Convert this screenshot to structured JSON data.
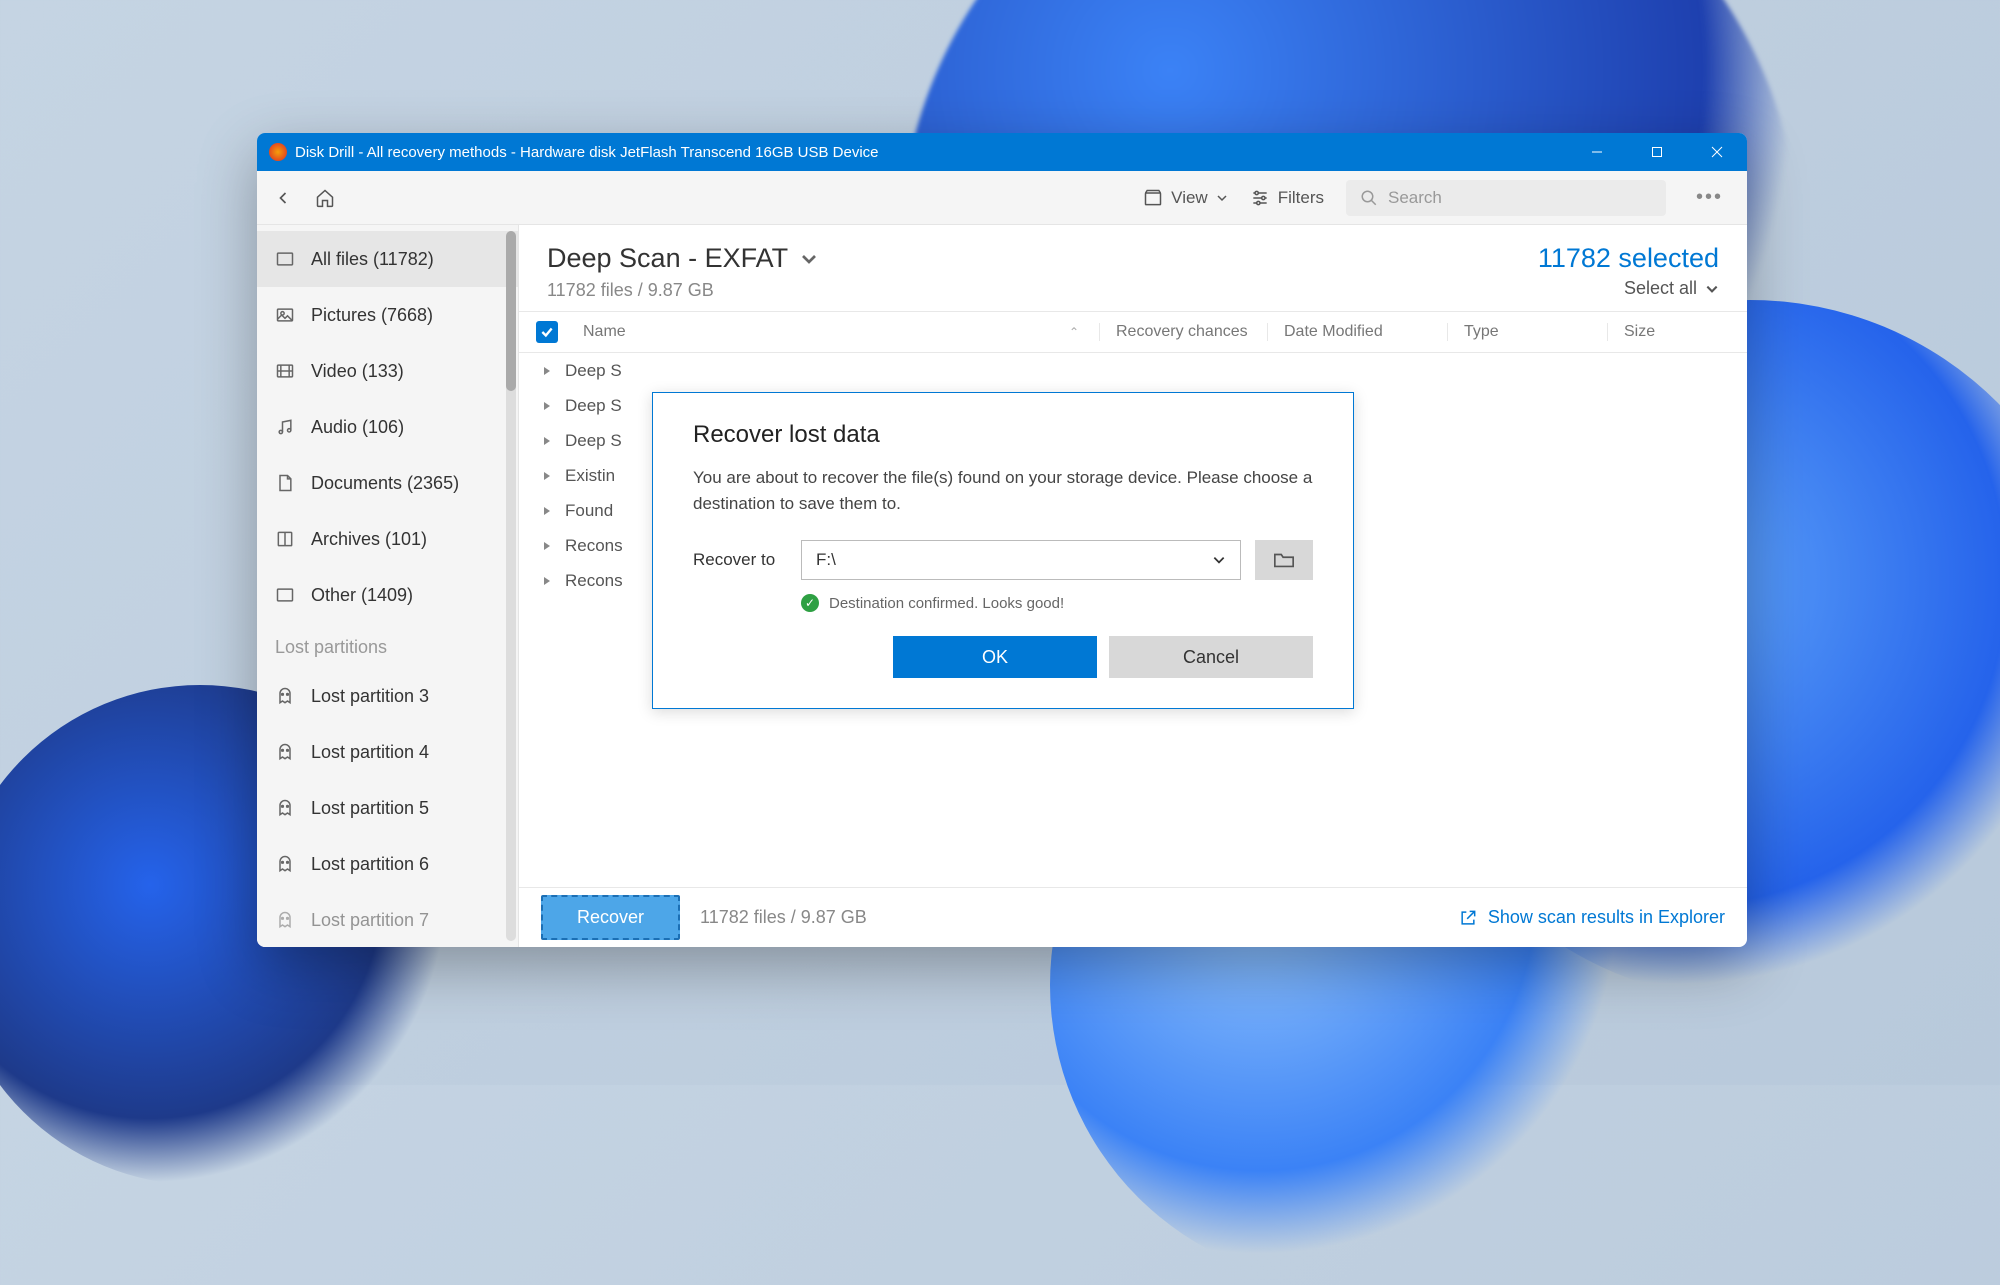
{
  "titlebar": {
    "title": "Disk Drill - All recovery methods - Hardware disk JetFlash Transcend 16GB USB Device"
  },
  "toolbar": {
    "view_label": "View",
    "filters_label": "Filters",
    "search_placeholder": "Search"
  },
  "sidebar": {
    "items": [
      {
        "label": "All files (11782)"
      },
      {
        "label": "Pictures (7668)"
      },
      {
        "label": "Video (133)"
      },
      {
        "label": "Audio (106)"
      },
      {
        "label": "Documents (2365)"
      },
      {
        "label": "Archives (101)"
      },
      {
        "label": "Other (1409)"
      }
    ],
    "section_label": "Lost partitions",
    "partitions": [
      {
        "label": "Lost partition 3"
      },
      {
        "label": "Lost partition 4"
      },
      {
        "label": "Lost partition 5"
      },
      {
        "label": "Lost partition 6"
      },
      {
        "label": "Lost partition 7"
      }
    ]
  },
  "main": {
    "title": "Deep Scan - EXFAT",
    "subtitle": "11782 files / 9.87 GB",
    "selected_text": "11782 selected",
    "select_all_label": "Select all",
    "columns": {
      "name": "Name",
      "recovery": "Recovery chances",
      "date": "Date Modified",
      "type": "Type",
      "size": "Size"
    },
    "rows": [
      {
        "label": "Deep S"
      },
      {
        "label": "Deep S"
      },
      {
        "label": "Deep S"
      },
      {
        "label": "Existin"
      },
      {
        "label": "Found"
      },
      {
        "label": "Recons"
      },
      {
        "label": "Recons"
      }
    ]
  },
  "footer": {
    "recover_label": "Recover",
    "info": "11782 files / 9.87 GB",
    "link_label": "Show scan results in Explorer"
  },
  "dialog": {
    "title": "Recover lost data",
    "text": "You are about to recover the file(s) found on your storage device. Please choose a destination to save them to.",
    "recover_to_label": "Recover to",
    "destination": "F:\\",
    "confirm_text": "Destination confirmed. Looks good!",
    "ok_label": "OK",
    "cancel_label": "Cancel"
  }
}
